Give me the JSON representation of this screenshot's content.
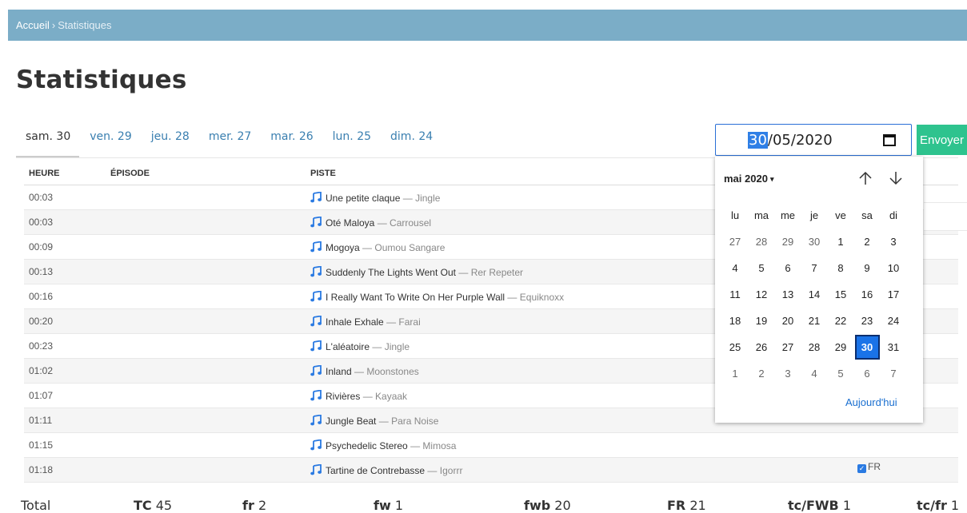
{
  "breadcrumb": {
    "home": "Accueil",
    "separator": "›",
    "current": "Statistiques"
  },
  "page_title": "Statistiques",
  "tabs": [
    {
      "label": "sam. 30",
      "active": true
    },
    {
      "label": "ven. 29",
      "active": false
    },
    {
      "label": "jeu. 28",
      "active": false
    },
    {
      "label": "mer. 27",
      "active": false
    },
    {
      "label": "mar. 26",
      "active": false
    },
    {
      "label": "lun. 25",
      "active": false
    },
    {
      "label": "dim. 24",
      "active": false
    }
  ],
  "date_input": {
    "day": "30",
    "rest": "/05/2020",
    "icon": "calendar-icon"
  },
  "send_button": "Envoyer",
  "table": {
    "headers": [
      "HEURE",
      "ÉPISODE",
      "PISTE"
    ],
    "rows": [
      {
        "time": "00:03",
        "title": "Une petite claque",
        "artist": "Jingle"
      },
      {
        "time": "00:03",
        "title": "Oté Maloya",
        "artist": "Carrousel"
      },
      {
        "time": "00:09",
        "title": "Mogoya",
        "artist": "Oumou Sangare"
      },
      {
        "time": "00:13",
        "title": "Suddenly The Lights Went Out",
        "artist": "Rer Repeter"
      },
      {
        "time": "00:16",
        "title": "I Really Want To Write On Her Purple Wall",
        "artist": "Equiknoxx"
      },
      {
        "time": "00:20",
        "title": "Inhale Exhale",
        "artist": "Farai"
      },
      {
        "time": "00:23",
        "title": "L'aléatoire",
        "artist": "Jingle"
      },
      {
        "time": "01:02",
        "title": "Inland",
        "artist": "Moonstones"
      },
      {
        "time": "01:07",
        "title": "Rivières",
        "artist": "Kayaak"
      },
      {
        "time": "01:11",
        "title": "Jungle Beat",
        "artist": "Para Noise"
      },
      {
        "time": "01:15",
        "title": "Psychedelic Stereo",
        "artist": "Mimosa"
      },
      {
        "time": "01:18",
        "title": "Tartine de Contrebasse",
        "artist": "Igorrr"
      }
    ],
    "dash": "—",
    "fr_label": "FR",
    "fr_checked": true
  },
  "calendar": {
    "month_label": "mai 2020",
    "caret": "▾",
    "weekdays": [
      "lu",
      "ma",
      "me",
      "je",
      "ve",
      "sa",
      "di"
    ],
    "days": [
      [
        "27",
        "28",
        "29",
        "30",
        "1",
        "2",
        "3"
      ],
      [
        "4",
        "5",
        "6",
        "7",
        "8",
        "9",
        "10"
      ],
      [
        "11",
        "12",
        "13",
        "14",
        "15",
        "16",
        "17"
      ],
      [
        "18",
        "19",
        "20",
        "21",
        "22",
        "23",
        "24"
      ],
      [
        "25",
        "26",
        "27",
        "28",
        "29",
        "30",
        "31"
      ],
      [
        "1",
        "2",
        "3",
        "4",
        "5",
        "6",
        "7"
      ]
    ],
    "selected_day": "30",
    "today_label": "Aujourd'hui"
  },
  "footer": [
    {
      "key": "Total",
      "value": ""
    },
    {
      "key": "TC",
      "value": "45"
    },
    {
      "key": "fr",
      "value": "2"
    },
    {
      "key": "fw",
      "value": "1"
    },
    {
      "key": "fwb",
      "value": "20"
    },
    {
      "key": "FR",
      "value": "21"
    },
    {
      "key": "tc/FWB",
      "value": "1"
    },
    {
      "key": "tc/fr",
      "value": "1"
    }
  ],
  "colors": {
    "header_bar": "#7badc7",
    "link": "#3a7fb0",
    "send": "#2ec38e",
    "selected": "#1a73e8"
  }
}
